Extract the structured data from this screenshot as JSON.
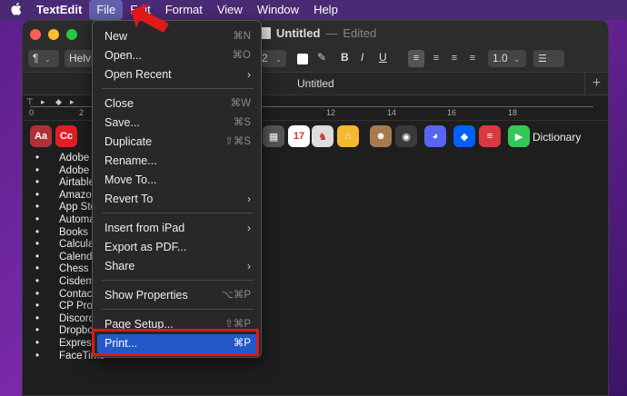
{
  "menubar": {
    "app": "TextEdit",
    "items": [
      "File",
      "Edit",
      "Format",
      "View",
      "Window",
      "Help"
    ]
  },
  "window": {
    "title": "Untitled",
    "separator": "—",
    "status": "Edited",
    "toolbar": {
      "paragraph_style": "¶",
      "font_family": "Helv",
      "font_size": "2",
      "line_spacing": "1.0"
    },
    "tab_title": "Untitled",
    "new_tab": "+",
    "ruler_labels": [
      "0",
      "2",
      "12",
      "14",
      "16",
      "18"
    ]
  },
  "document": {
    "icons": [
      {
        "name": "dictionary-app-icon",
        "glyph": "Aa",
        "color": "#b0303a"
      },
      {
        "name": "adobe-cc-app-icon",
        "glyph": "Cc",
        "color": "#e01e24"
      },
      {
        "name": "calculator-app-icon",
        "glyph": "▦",
        "color": "#555555"
      },
      {
        "name": "calendar-app-icon",
        "glyph": "17",
        "color": "#ffffff"
      },
      {
        "name": "chess-app-icon",
        "glyph": "♞",
        "color": "#dddddd"
      },
      {
        "name": "home-app-icon",
        "glyph": "⌂",
        "color": "#f5b830"
      },
      {
        "name": "contacts-app-icon",
        "glyph": "☻",
        "color": "#a87a50"
      },
      {
        "name": "camera-app-icon",
        "glyph": "◉",
        "color": "#3a3a3a"
      },
      {
        "name": "discord-app-icon",
        "glyph": "◕",
        "color": "#5865f2"
      },
      {
        "name": "dropbox-app-icon",
        "glyph": "◆",
        "color": "#0061fe"
      },
      {
        "name": "expressvpn-app-icon",
        "glyph": "≡",
        "color": "#da3940"
      },
      {
        "name": "facetime-app-icon",
        "glyph": "▶",
        "color": "#34c759"
      }
    ],
    "dict_label": "Dictionary",
    "bullet": "•",
    "list": [
      "Adobe",
      "Adobe",
      "Airtable",
      "Amazo",
      "App Sto",
      "Automa",
      "Books",
      "Calcula",
      "Calend",
      "Chess",
      "Cisdem",
      "Contac",
      "CP Pro",
      "Discord",
      "Dropbo",
      "Expres",
      "FaceTime"
    ]
  },
  "file_menu": {
    "items": [
      {
        "label": "New",
        "shortcut": "⌘N"
      },
      {
        "label": "Open...",
        "shortcut": "⌘O"
      },
      {
        "label": "Open Recent",
        "submenu": "›"
      },
      {
        "label": "Close",
        "shortcut": "⌘W"
      },
      {
        "label": "Save...",
        "shortcut": "⌘S"
      },
      {
        "label": "Duplicate",
        "shortcut": "⇧⌘S"
      },
      {
        "label": "Rename..."
      },
      {
        "label": "Move To..."
      },
      {
        "label": "Revert To",
        "submenu": "›"
      },
      {
        "label": "Insert from iPad",
        "submenu": "›"
      },
      {
        "label": "Export as PDF..."
      },
      {
        "label": "Share",
        "submenu": "›"
      },
      {
        "label": "Show Properties",
        "shortcut": "⌥⌘P"
      },
      {
        "label": "Page Setup...",
        "shortcut": "⇧⌘P"
      },
      {
        "label": "Print...",
        "shortcut": "⌘P"
      }
    ]
  },
  "colors": {
    "highlight": "#2458c8",
    "annotation_red": "#e01818"
  }
}
